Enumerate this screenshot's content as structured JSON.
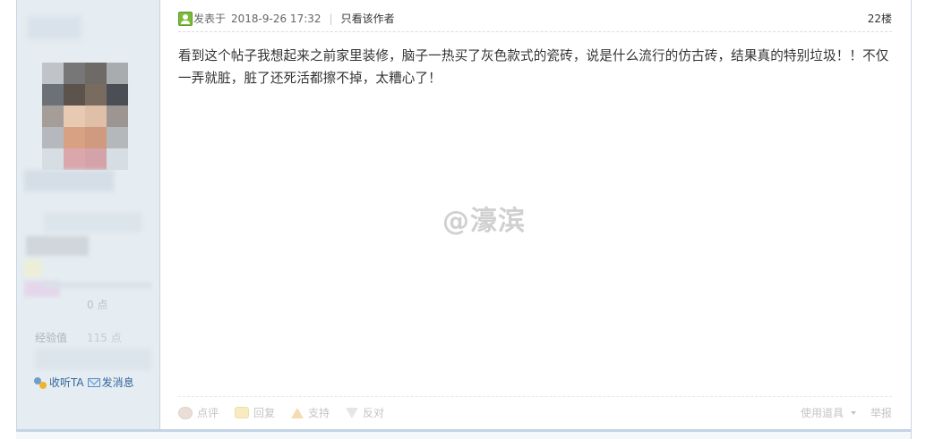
{
  "post": {
    "posted_label": "发表于",
    "posted_time": "2018-9-26 17:32",
    "separator": "|",
    "author_only_label": "只看该作者",
    "floor": "22楼",
    "body_text": "看到这个帖子我想起来之前家里装修，脑子一热买了灰色款式的瓷砖，说是什么流行的仿古砖，结果真的特别垃圾！！不仅一弄就脏，脏了还死活都擦不掉，太糟心了！",
    "watermark": "@濠滨"
  },
  "sidebar": {
    "points_label": "0 点",
    "exp_label": "经验值",
    "exp_value": "115 点",
    "listen_label": "收听TA",
    "message_label": "发消息",
    "avatar_colors": [
      [
        "#c0c4c9",
        "#777777",
        "#6e6a66",
        "#a9acae"
      ],
      [
        "#6c7178",
        "#5b534c",
        "#7a6b60",
        "#4b4f55"
      ],
      [
        "#a59d97",
        "#e8c9b2",
        "#e0bfa8",
        "#9c9591"
      ],
      [
        "#b5b9bd",
        "#d9a184",
        "#cf9a7f",
        "#b4b8bb"
      ],
      [
        "#d6dde3",
        "#dba7ad",
        "#d4a3a9",
        "#d6dde3"
      ]
    ]
  },
  "footer": {
    "comment_label": "点评",
    "reply_label": "回复",
    "support_label": "支持",
    "oppose_label": "反对",
    "tools_label": "使用道具",
    "report_label": "举报"
  }
}
